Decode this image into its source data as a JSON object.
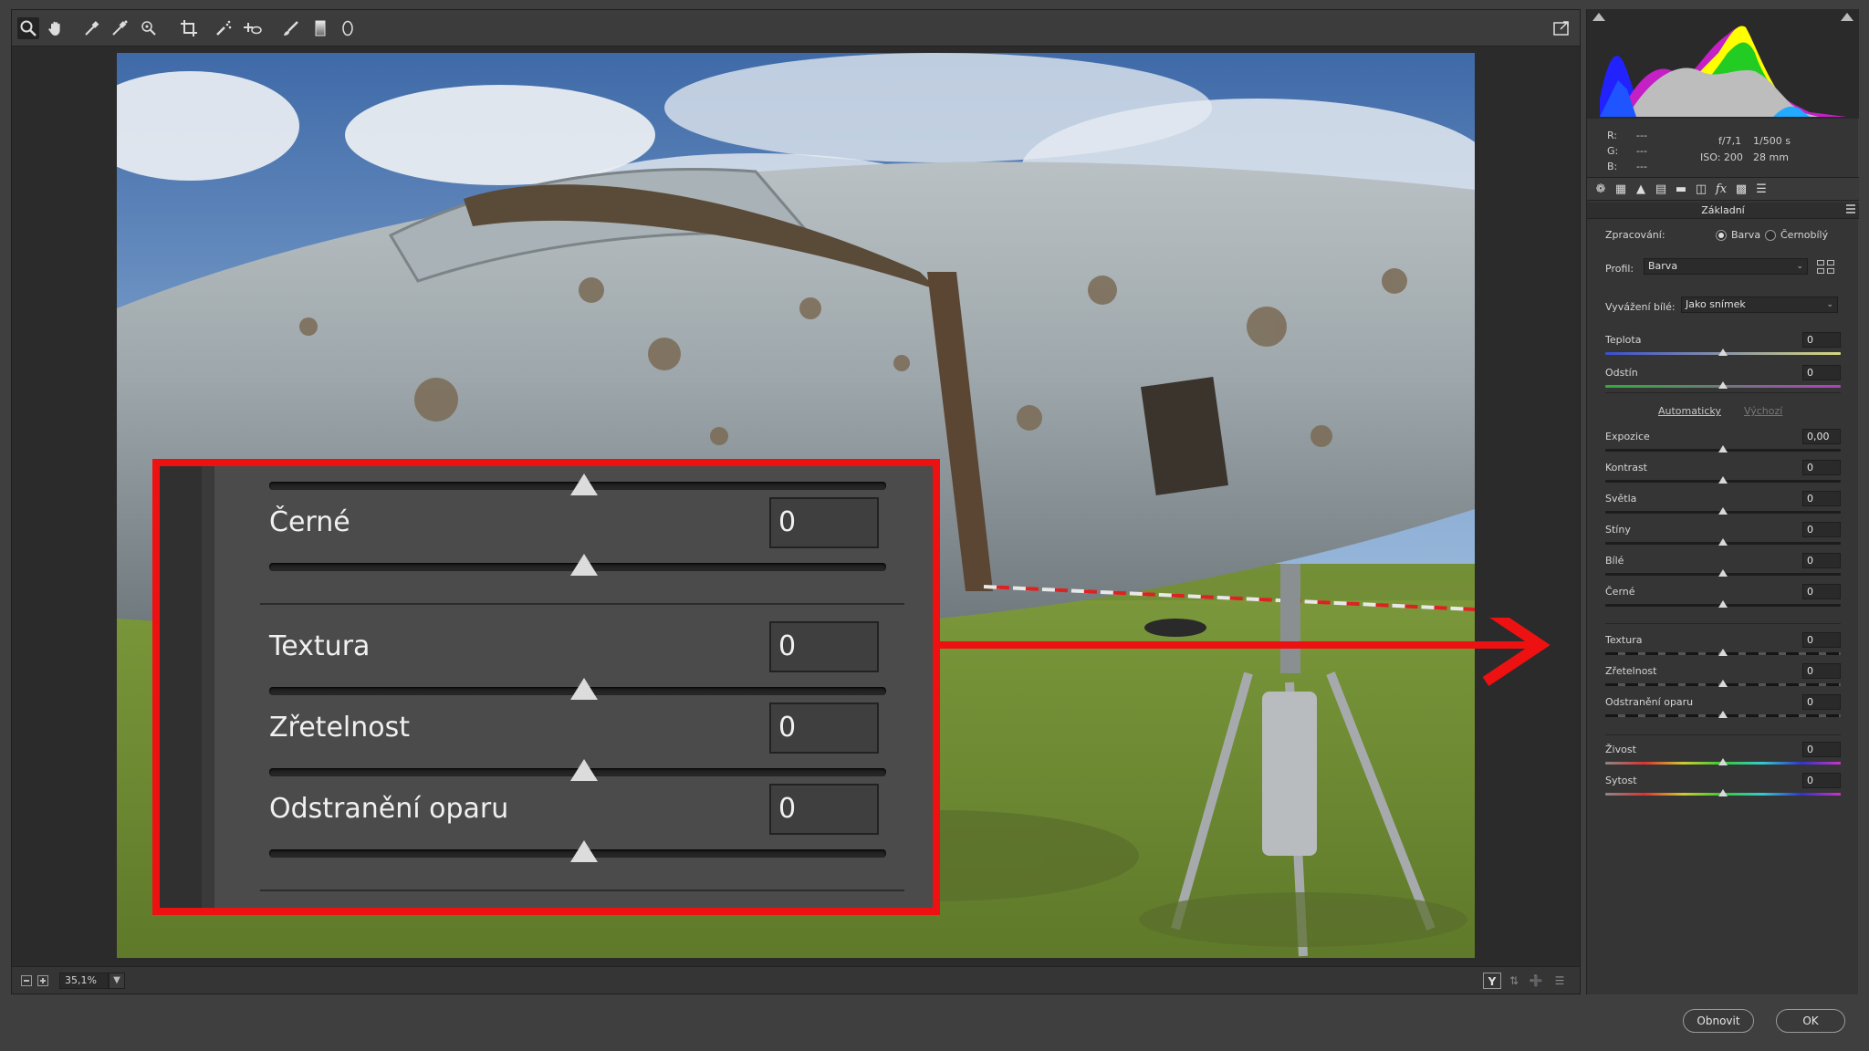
{
  "toolbar": {
    "tools": [
      "zoom-icon",
      "hand-icon",
      "white-balance-icon",
      "color-sampler-icon",
      "targeted-adjustment-icon",
      "crop-icon",
      "spot-removal-icon",
      "red-eye-icon",
      "adjustment-brush-icon",
      "graduated-filter-icon",
      "radial-filter-icon"
    ],
    "open_preferences": "fullscreen-toggle-icon"
  },
  "statusbar": {
    "zoom_level": "35,1%",
    "view_mode": "Y"
  },
  "info": {
    "r_label": "R:",
    "r_value": "---",
    "g_label": "G:",
    "g_value": "---",
    "b_label": "B:",
    "b_value": "---",
    "aperture": "f/7,1",
    "shutter": "1/500 s",
    "iso": "ISO: 200",
    "focal": "28 mm"
  },
  "panel": {
    "title": "Základní",
    "processing_label": "Zpracování:",
    "processing_color": "Barva",
    "processing_bw": "Černobílý",
    "profile_label": "Profil:",
    "profile_value": "Barva",
    "wb_label": "Vyvážení bílé:",
    "wb_value": "Jako snímek",
    "auto_link": "Automaticky",
    "default_link": "Výchozí",
    "sliders": [
      {
        "label": "Teplota",
        "value": "0",
        "position": 0.5
      },
      {
        "label": "Odstín",
        "value": "0",
        "position": 0.5
      },
      {
        "label": "Expozice",
        "value": "0,00",
        "position": 0.5
      },
      {
        "label": "Kontrast",
        "value": "0",
        "position": 0.5
      },
      {
        "label": "Světla",
        "value": "0",
        "position": 0.5
      },
      {
        "label": "Stíny",
        "value": "0",
        "position": 0.5
      },
      {
        "label": "Bílé",
        "value": "0",
        "position": 0.5
      },
      {
        "label": "Černé",
        "value": "0",
        "position": 0.5
      },
      {
        "label": "Textura",
        "value": "0",
        "position": 0.5
      },
      {
        "label": "Zřetelnost",
        "value": "0",
        "position": 0.5
      },
      {
        "label": "Odstranění oparu",
        "value": "0",
        "position": 0.5
      },
      {
        "label": "Živost",
        "value": "0",
        "position": 0.5
      },
      {
        "label": "Sytost",
        "value": "0",
        "position": 0.5
      }
    ]
  },
  "callout": {
    "sliders": [
      {
        "label": "Černé",
        "value": "0",
        "position": 0.5
      },
      {
        "label": "Textura",
        "value": "0",
        "position": 0.5
      },
      {
        "label": "Zřetelnost",
        "value": "0",
        "position": 0.5
      },
      {
        "label": "Odstranění oparu",
        "value": "0",
        "position": 0.5
      }
    ]
  },
  "footer": {
    "reset_label": "Obnovit",
    "ok_label": "OK"
  },
  "colors": {
    "callout_border": "#ee1111",
    "panel_bg": "#353535",
    "app_bg": "#3f3f3f"
  }
}
